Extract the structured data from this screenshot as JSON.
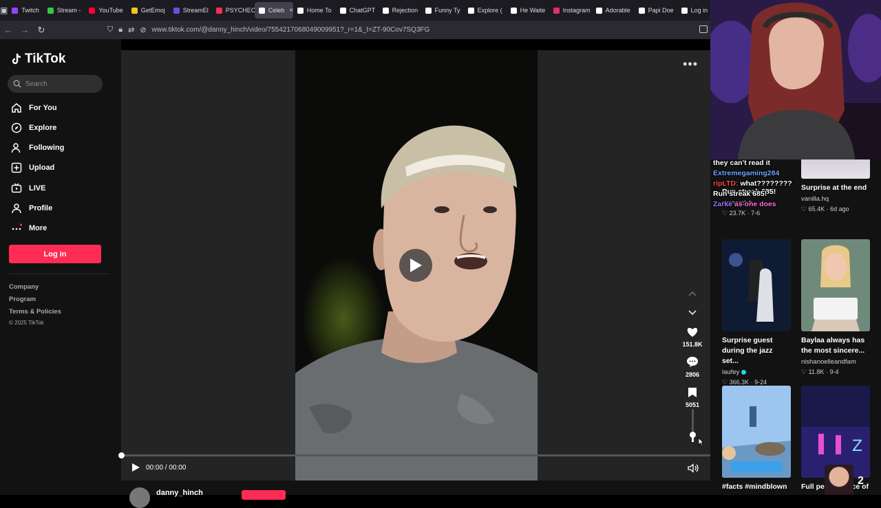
{
  "browser": {
    "tabs": [
      {
        "label": "Twitch",
        "color": "#9146ff"
      },
      {
        "label": "Stream -",
        "color": "#2ecc40"
      },
      {
        "label": "YouTube",
        "color": "#ff0033"
      },
      {
        "label": "GetEmoj",
        "color": "#f5c518"
      },
      {
        "label": "StreamEl",
        "color": "#6c4ed8"
      },
      {
        "label": "PSYCHEC",
        "color": "#ff2d55"
      },
      {
        "label": "Celeb",
        "color": "#ffffff",
        "active": true
      },
      {
        "label": "Home To",
        "color": "#ffffff"
      },
      {
        "label": "ChatGPT",
        "color": "#ffffff"
      },
      {
        "label": "Rejection",
        "color": "#ffffff"
      },
      {
        "label": "Funny Ty",
        "color": "#ffffff"
      },
      {
        "label": "Explore (",
        "color": "#ffffff"
      },
      {
        "label": "He Waite",
        "color": "#ffffff"
      },
      {
        "label": "Instagram",
        "color": "#e1306c"
      },
      {
        "label": "Adorable",
        "color": "#ffffff"
      },
      {
        "label": "Papi Doe",
        "color": "#ffffff"
      },
      {
        "label": "Log in",
        "color": "#ffffff"
      }
    ],
    "url": "www.tiktok.com/@danny_hinch/video/7554217068049009951?_r=1&_t=ZT-90Cov7SQ3FG"
  },
  "sidebar": {
    "logo": "TikTok",
    "search_placeholder": "Search",
    "nav": [
      {
        "label": "For You",
        "icon": "home-icon"
      },
      {
        "label": "Explore",
        "icon": "compass-icon"
      },
      {
        "label": "Following",
        "icon": "person-icon"
      },
      {
        "label": "Upload",
        "icon": "plus-square-icon"
      },
      {
        "label": "LIVE",
        "icon": "live-tv-icon"
      },
      {
        "label": "Profile",
        "icon": "profile-icon"
      },
      {
        "label": "More",
        "icon": "more-dots-icon"
      }
    ],
    "login": "Log in",
    "footer": [
      "Company",
      "Program",
      "Terms & Policies"
    ],
    "copyright": "© 2025 TikTok"
  },
  "player": {
    "likes": "151.8K",
    "comments": "2806",
    "saves": "5051",
    "time": "00:00 / 00:00",
    "progress": 0,
    "volume": 0.2
  },
  "author": {
    "username": "danny_hinch"
  },
  "chat": [
    {
      "user": "",
      "text": "they can't read it"
    },
    {
      "user": "Extremegaming284",
      "text": ""
    },
    {
      "user": "ripLTD:",
      "text": "what????????"
    },
    {
      "user": "",
      "text": "Run streak 685!"
    },
    {
      "user": "Zarke",
      "text": "as one does"
    }
  ],
  "recommended": [
    {
      "title": "Run streak 685!",
      "author": "runnerclub",
      "likes": "23.7K",
      "date": "7-6"
    },
    {
      "title": "Surprise at the end",
      "author": "vanilla.hq",
      "likes": "65.4K",
      "date": "6d ago"
    },
    {
      "title": "Surprise guest during the jazz set...",
      "author": "laufey",
      "likes": "366.3K",
      "date": "9-24",
      "verified": true
    },
    {
      "title": "Baylaa always has the most sincere...",
      "author": "nishanoelleandfam",
      "likes": "11.8K",
      "date": "9-4"
    },
    {
      "title": "#facts #mindblown",
      "author": "",
      "likes": "",
      "date": ""
    },
    {
      "title": "Full performance of",
      "author": "",
      "likes": "",
      "date": ""
    }
  ],
  "overlay_number": "2"
}
